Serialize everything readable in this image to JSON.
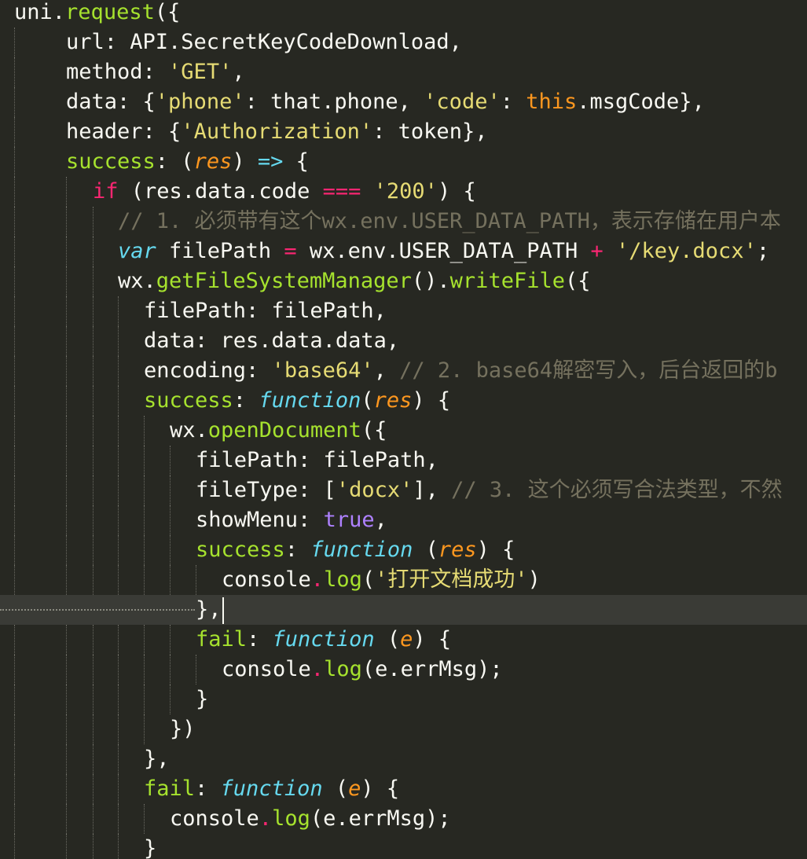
{
  "editor": {
    "lines": [
      [
        {
          "t": "uni",
          "c": "plain"
        },
        {
          "t": ".",
          "c": "plain"
        },
        {
          "t": "request",
          "c": "fn"
        },
        {
          "t": "({",
          "c": "plain"
        }
      ],
      [
        {
          "t": "url: API.SecretKeyCodeDownload,",
          "c": "plain"
        }
      ],
      [
        {
          "t": "method: ",
          "c": "plain"
        },
        {
          "t": "'GET'",
          "c": "str"
        },
        {
          "t": ",",
          "c": "plain"
        }
      ],
      [
        {
          "t": "data: {",
          "c": "plain"
        },
        {
          "t": "'phone'",
          "c": "str"
        },
        {
          "t": ": that.phone, ",
          "c": "plain"
        },
        {
          "t": "'code'",
          "c": "str"
        },
        {
          "t": ": ",
          "c": "plain"
        },
        {
          "t": "this",
          "c": "this"
        },
        {
          "t": ".msgCode},",
          "c": "plain"
        }
      ],
      [
        {
          "t": "header: {",
          "c": "plain"
        },
        {
          "t": "'Authorization'",
          "c": "str"
        },
        {
          "t": ": token},",
          "c": "plain"
        }
      ],
      [
        {
          "t": "success",
          "c": "prop"
        },
        {
          "t": ": (",
          "c": "plain"
        },
        {
          "t": "res",
          "c": "param"
        },
        {
          "t": ") ",
          "c": "plain"
        },
        {
          "t": "=>",
          "c": "arrow"
        },
        {
          "t": " {",
          "c": "plain"
        }
      ],
      [
        {
          "t": "if",
          "c": "kw"
        },
        {
          "t": " (res.data.code ",
          "c": "plain"
        },
        {
          "t": "===",
          "c": "op"
        },
        {
          "t": " ",
          "c": "plain"
        },
        {
          "t": "'200'",
          "c": "str"
        },
        {
          "t": ") {",
          "c": "plain"
        }
      ],
      [
        {
          "t": "// 1. 必须带有这个wx.env.USER_DATA_PATH，表示存储在用户本",
          "c": "cm"
        }
      ],
      [
        {
          "t": "var",
          "c": "storage"
        },
        {
          "t": " filePath ",
          "c": "plain"
        },
        {
          "t": "=",
          "c": "op"
        },
        {
          "t": " wx.env.USER_DATA_PATH ",
          "c": "plain"
        },
        {
          "t": "+",
          "c": "op"
        },
        {
          "t": " ",
          "c": "plain"
        },
        {
          "t": "'/key.docx'",
          "c": "str"
        },
        {
          "t": ";",
          "c": "plain"
        }
      ],
      [
        {
          "t": "wx.",
          "c": "plain"
        },
        {
          "t": "getFileSystemManager",
          "c": "fn"
        },
        {
          "t": "().",
          "c": "plain"
        },
        {
          "t": "writeFile",
          "c": "fn"
        },
        {
          "t": "({",
          "c": "plain"
        }
      ],
      [
        {
          "t": "filePath: filePath,",
          "c": "plain"
        }
      ],
      [
        {
          "t": "data: res.data.data,",
          "c": "plain"
        }
      ],
      [
        {
          "t": "encoding: ",
          "c": "plain"
        },
        {
          "t": "'base64'",
          "c": "str"
        },
        {
          "t": ", ",
          "c": "plain"
        },
        {
          "t": "// 2. base64解密写入，后台返回的b",
          "c": "cm"
        }
      ],
      [
        {
          "t": "success",
          "c": "prop"
        },
        {
          "t": ": ",
          "c": "plain"
        },
        {
          "t": "function",
          "c": "storage"
        },
        {
          "t": "(",
          "c": "plain"
        },
        {
          "t": "res",
          "c": "param"
        },
        {
          "t": ") {",
          "c": "plain"
        }
      ],
      [
        {
          "t": "wx.",
          "c": "plain"
        },
        {
          "t": "openDocument",
          "c": "fn"
        },
        {
          "t": "({",
          "c": "plain"
        }
      ],
      [
        {
          "t": "filePath: filePath,",
          "c": "plain"
        }
      ],
      [
        {
          "t": "fileType: [",
          "c": "plain"
        },
        {
          "t": "'docx'",
          "c": "str"
        },
        {
          "t": "], ",
          "c": "plain"
        },
        {
          "t": "// 3. 这个必须写合法类型，不然",
          "c": "cm"
        }
      ],
      [
        {
          "t": "showMenu: ",
          "c": "plain"
        },
        {
          "t": "true",
          "c": "const"
        },
        {
          "t": ",",
          "c": "plain"
        }
      ],
      [
        {
          "t": "success",
          "c": "prop"
        },
        {
          "t": ": ",
          "c": "plain"
        },
        {
          "t": "function",
          "c": "storage"
        },
        {
          "t": " (",
          "c": "plain"
        },
        {
          "t": "res",
          "c": "param"
        },
        {
          "t": ") {",
          "c": "plain"
        }
      ],
      [
        {
          "t": "console",
          "c": "plain"
        },
        {
          "t": ".",
          "c": "op"
        },
        {
          "t": "log",
          "c": "fn"
        },
        {
          "t": "(",
          "c": "plain"
        },
        {
          "t": "'打开文档成功'",
          "c": "str"
        },
        {
          "t": ")",
          "c": "plain"
        }
      ],
      [
        {
          "t": "},",
          "c": "plain"
        }
      ],
      [
        {
          "t": "fail",
          "c": "prop"
        },
        {
          "t": ": ",
          "c": "plain"
        },
        {
          "t": "function",
          "c": "storage"
        },
        {
          "t": " (",
          "c": "plain"
        },
        {
          "t": "e",
          "c": "param"
        },
        {
          "t": ") {",
          "c": "plain"
        }
      ],
      [
        {
          "t": "console",
          "c": "plain"
        },
        {
          "t": ".",
          "c": "op"
        },
        {
          "t": "log",
          "c": "fn"
        },
        {
          "t": "(e.errMsg);",
          "c": "plain"
        }
      ],
      [
        {
          "t": "}",
          "c": "plain"
        }
      ],
      [
        {
          "t": "})",
          "c": "plain"
        }
      ],
      [
        {
          "t": "},",
          "c": "plain"
        }
      ],
      [
        {
          "t": "fail",
          "c": "prop"
        },
        {
          "t": ": ",
          "c": "plain"
        },
        {
          "t": "function",
          "c": "storage"
        },
        {
          "t": " (",
          "c": "plain"
        },
        {
          "t": "e",
          "c": "param"
        },
        {
          "t": ") {",
          "c": "plain"
        }
      ],
      [
        {
          "t": "console",
          "c": "plain"
        },
        {
          "t": ".",
          "c": "op"
        },
        {
          "t": "log",
          "c": "fn"
        },
        {
          "t": "(e.errMsg);",
          "c": "plain"
        }
      ],
      [
        {
          "t": "}",
          "c": "plain"
        }
      ]
    ],
    "colors": {
      "background": "#272822",
      "active_line": "#3a3b36",
      "text": "#f8f8f2",
      "function": "#a6e22e",
      "string": "#e6db74",
      "keyword": "#f92672",
      "storage": "#66d9ef",
      "parameter": "#fd971f",
      "constant": "#ae81ff",
      "comment": "#75715e"
    }
  }
}
